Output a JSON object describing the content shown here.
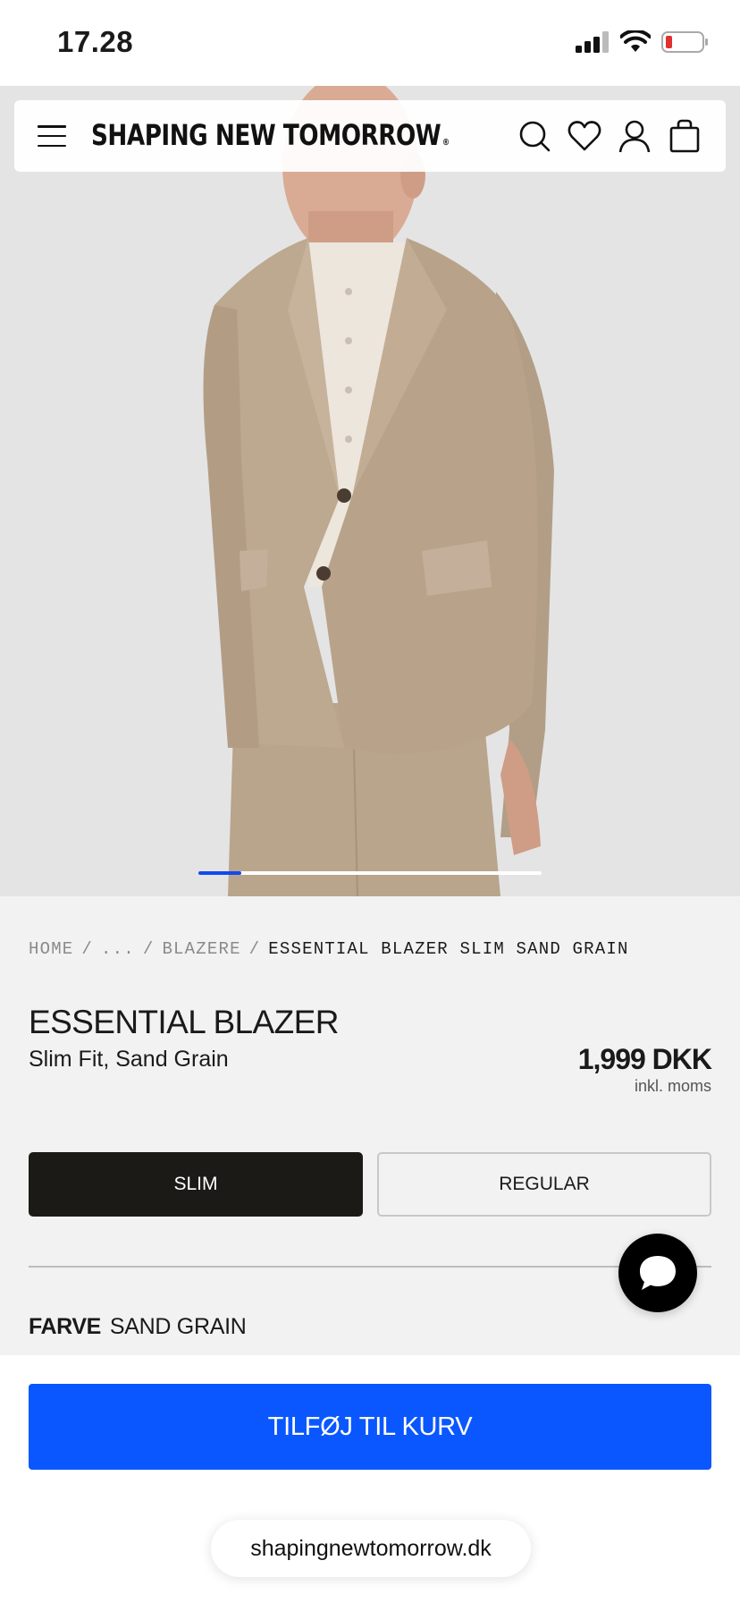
{
  "status_bar": {
    "time": "17.28",
    "icons": [
      "cellular-signal-icon",
      "wifi-icon",
      "battery-low-icon"
    ]
  },
  "header": {
    "logo": "SHAPING NEW TOMORROW",
    "logo_mark": "®",
    "icons": [
      "menu-icon",
      "search-icon",
      "heart-icon",
      "account-icon",
      "bag-icon"
    ]
  },
  "gallery": {
    "progress": 0.125,
    "accent_color": "#1149f0"
  },
  "breadcrumb": {
    "items": [
      "HOME",
      "...",
      "BLAZERE"
    ],
    "separator": "/",
    "current": "ESSENTIAL BLAZER SLIM SAND GRAIN"
  },
  "product": {
    "title": "ESSENTIAL BLAZER",
    "subtitle": "Slim Fit, Sand Grain",
    "price": "1,999 DKK",
    "price_note": "inkl. moms"
  },
  "fit_options": {
    "selected": "SLIM",
    "options": [
      "SLIM",
      "REGULAR"
    ]
  },
  "color": {
    "label": "FARVE",
    "value": "SAND GRAIN"
  },
  "cta": {
    "label": "TILFØJ TIL KURV",
    "color": "#0a57ff"
  },
  "browser": {
    "url": "shapingnewtomorrow.dk"
  }
}
